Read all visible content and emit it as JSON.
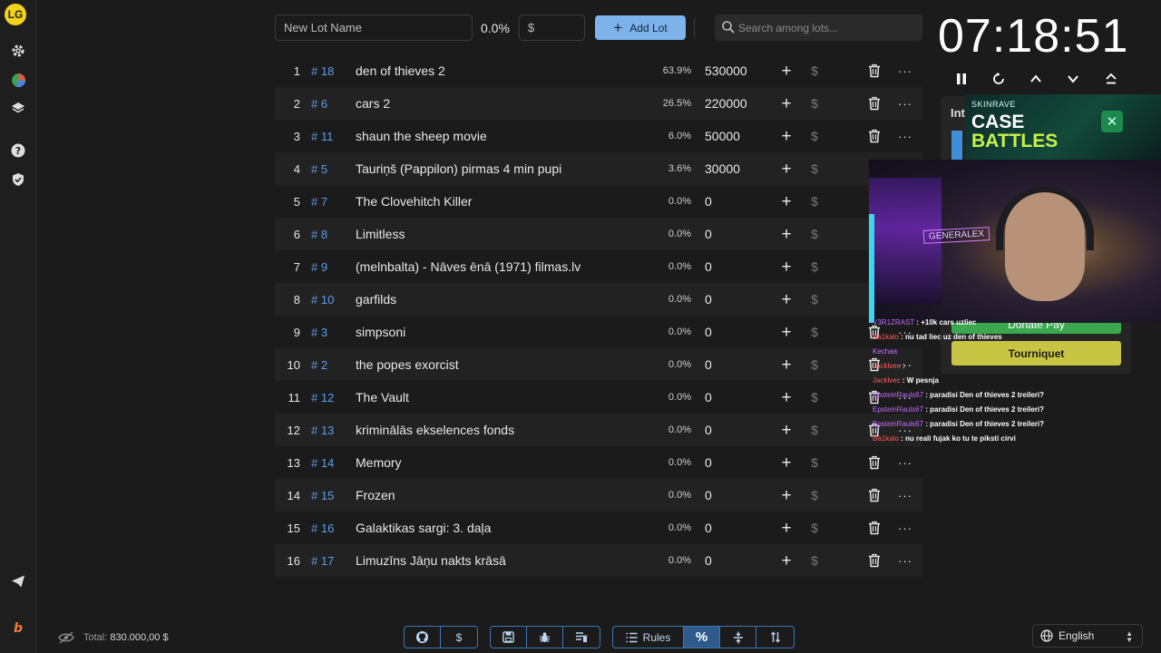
{
  "sidebar": {
    "avatar_text": "LG",
    "icons": [
      "gear-icon",
      "pie-chart-icon",
      "layers-icon",
      "help-icon",
      "shield-icon",
      "send-icon",
      "brand-icon"
    ]
  },
  "toolbar": {
    "lot_name_placeholder": "New Lot Name",
    "percent": "0.0%",
    "amount_placeholder": "$",
    "add_lot_label": "Add Lot",
    "search_placeholder": "Search among lots..."
  },
  "lots": [
    {
      "index": "1",
      "id": "# 18",
      "name": "den of thieves 2",
      "percent": "63.9%",
      "amount": "530000"
    },
    {
      "index": "2",
      "id": "# 6",
      "name": "cars 2",
      "percent": "26.5%",
      "amount": "220000"
    },
    {
      "index": "3",
      "id": "# 11",
      "name": "shaun the sheep movie",
      "percent": "6.0%",
      "amount": "50000"
    },
    {
      "index": "4",
      "id": "# 5",
      "name": "Tauriņš (Pappilon) pirmas 4 min pupi",
      "percent": "3.6%",
      "amount": "30000"
    },
    {
      "index": "5",
      "id": "# 7",
      "name": "The Clovehitch Killer",
      "percent": "0.0%",
      "amount": "0"
    },
    {
      "index": "6",
      "id": "# 8",
      "name": "Limitless",
      "percent": "0.0%",
      "amount": "0"
    },
    {
      "index": "7",
      "id": "# 9",
      "name": "(melnbalta) - Nāves ēnā (1971) filmas.lv",
      "percent": "0.0%",
      "amount": "0"
    },
    {
      "index": "8",
      "id": "# 10",
      "name": "garfilds",
      "percent": "0.0%",
      "amount": "0"
    },
    {
      "index": "9",
      "id": "# 3",
      "name": "simpsoni",
      "percent": "0.0%",
      "amount": "0"
    },
    {
      "index": "10",
      "id": "# 2",
      "name": "the popes exorcist",
      "percent": "0.0%",
      "amount": "0"
    },
    {
      "index": "11",
      "id": "# 12",
      "name": "The Vault",
      "percent": "0.0%",
      "amount": "0"
    },
    {
      "index": "12",
      "id": "# 13",
      "name": "kriminālās ekselences fonds",
      "percent": "0.0%",
      "amount": "0"
    },
    {
      "index": "13",
      "id": "# 14",
      "name": "Memory",
      "percent": "0.0%",
      "amount": "0"
    },
    {
      "index": "14",
      "id": "# 15",
      "name": "Frozen",
      "percent": "0.0%",
      "amount": "0"
    },
    {
      "index": "15",
      "id": "# 16",
      "name": "Galaktikas sargi: 3. daļa",
      "percent": "0.0%",
      "amount": "0"
    },
    {
      "index": "16",
      "id": "# 17",
      "name": "Limuzīns Jāņu nakts krāsā",
      "percent": "0.0%",
      "amount": "0"
    }
  ],
  "lot_actions": {
    "add": "+",
    "dollar": "$",
    "more": "···"
  },
  "timer": {
    "time": "07:18:51",
    "controls": [
      "pause-icon",
      "reset-icon",
      "chevron-up-icon",
      "chevron-down-icon",
      "eject-icon"
    ]
  },
  "side_panel": {
    "title": "Int",
    "donate_label": "Donate Pay",
    "tourniquet_label": "Tourniquet"
  },
  "overlay_ad": {
    "brand": "SKINRAVE",
    "title_line1": "CASE",
    "title_line2": "BATTLES"
  },
  "webcam": {
    "sign_text": "GENERALEX"
  },
  "chat": [
    {
      "user": "V3R1ZRAST",
      "msg": ": +10k cars uzliec",
      "color": "u2"
    },
    {
      "user": "Ba1kalo",
      "msg": ": nu tad liec uz den of thieves",
      "color": "u1"
    },
    {
      "user": "Kechaa",
      "msg": "",
      "color": "u2"
    },
    {
      "user": "Jacklvec",
      "msg": ":",
      "color": "u1"
    },
    {
      "user": "Jacklvec",
      "msg": ": W pesnja",
      "color": "u1"
    },
    {
      "user": "EpsteinRauls67",
      "msg": ": paradisi Den of thieves 2 treileri?",
      "color": "u2"
    },
    {
      "user": "EpsteinRauls67",
      "msg": ": paradisi Den of thieves 2 treileri?",
      "color": "u2"
    },
    {
      "user": "EpsteinRauls67",
      "msg": ": paradisi Den of thieves 2 treileri?",
      "color": "u2"
    },
    {
      "user": "Ba1kalo",
      "msg": ": nu reali fujak ko tu te piksti cirvi",
      "color": "u1"
    }
  ],
  "footer": {
    "total_label": "Total:",
    "total_value": "830.000,00 $",
    "rules_label": "Rules",
    "percent_symbol": "%",
    "dollar_symbol": "$",
    "language": "English"
  },
  "colors": {
    "accent": "#7db2ea",
    "id_blue": "#5e9de6",
    "background": "#1b1b1b",
    "donate_green": "#3ba74f",
    "tourniquet_yellow": "#c8c544"
  }
}
